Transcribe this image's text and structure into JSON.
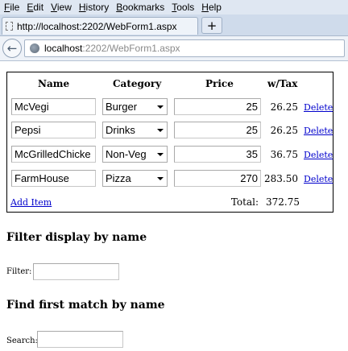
{
  "browser": {
    "menu": [
      "File",
      "Edit",
      "View",
      "History",
      "Bookmarks",
      "Tools",
      "Help"
    ],
    "tab_title": "http://localhost:2202/WebForm1.aspx",
    "new_tab_symbol": "+",
    "url_host": "localhost",
    "url_rest": ":2202/WebForm1.aspx"
  },
  "grid": {
    "headers": {
      "name": "Name",
      "category": "Category",
      "price": "Price",
      "with_tax": "w/Tax"
    },
    "rows": [
      {
        "name": "McVegi",
        "category": "Burger",
        "price": "25",
        "with_tax": "26.25",
        "delete": "Delete"
      },
      {
        "name": "Pepsi",
        "category": "Drinks",
        "price": "25",
        "with_tax": "26.25",
        "delete": "Delete"
      },
      {
        "name": "McGrilledChicke",
        "category": "Non-Veg",
        "price": "35",
        "with_tax": "36.75",
        "delete": "Delete"
      },
      {
        "name": "FarmHouse",
        "category": "Pizza",
        "price": "270",
        "with_tax": "283.50",
        "delete": "Delete"
      }
    ],
    "add_item": "Add Item",
    "total_label": "Total:",
    "total_value": "372.75"
  },
  "filter": {
    "heading": "Filter display by name",
    "label": "Filter:",
    "value": ""
  },
  "search": {
    "heading": "Find first match by name",
    "label": "Search:",
    "value": ""
  },
  "icons": {
    "back": "back-arrow-icon",
    "site": "globe-icon",
    "page": "page-icon",
    "dropdown": "chevron-down-icon"
  }
}
